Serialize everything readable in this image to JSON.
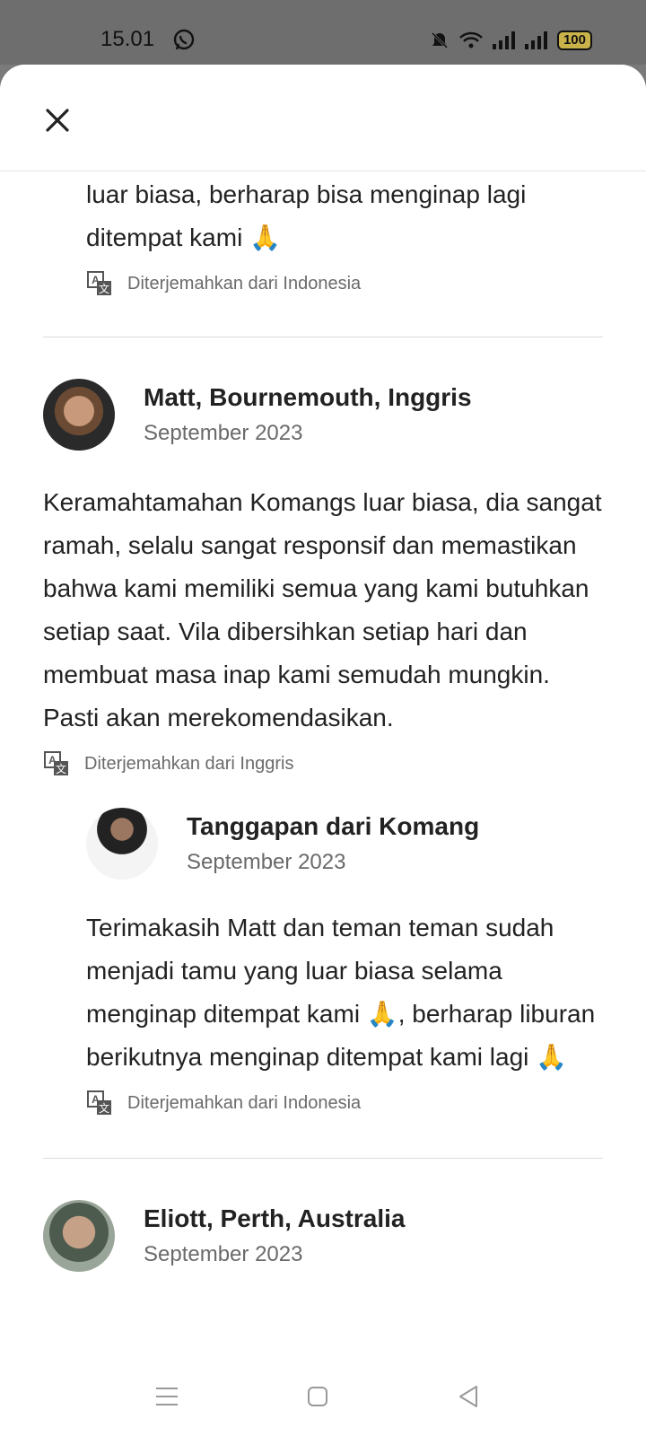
{
  "status_bar": {
    "time": "15.01",
    "battery": "100",
    "icons": [
      "whatsapp-icon",
      "mute-icon",
      "wifi-icon",
      "signal-icon",
      "signal-icon",
      "battery-icon"
    ]
  },
  "header": {
    "close_icon": "close-icon"
  },
  "reviews": {
    "prev_response": {
      "text": "luar biasa, berharap bisa menginap lagi ditempat kami 🙏",
      "translated": "Diterjemahkan dari Indonesia"
    },
    "matt": {
      "name": "Matt, Bournemouth, Inggris",
      "date": "September 2023",
      "text": "Keramahtamahan Komangs luar biasa, dia sangat ramah, selalu sangat responsif dan memastikan bahwa kami memiliki semua yang kami butuhkan setiap saat. Vila dibersihkan setiap hari dan membuat masa inap kami semudah mungkin. Pasti akan merekomendasikan.",
      "translated": "Diterjemahkan dari Inggris"
    },
    "komang_response": {
      "name": "Tanggapan dari Komang",
      "date": "September 2023",
      "text": "Terimakasih Matt dan teman teman sudah menjadi tamu yang luar biasa selama menginap ditempat kami 🙏, berharap liburan berikutnya menginap ditempat kami lagi 🙏",
      "translated": "Diterjemahkan dari Indonesia"
    },
    "eliott": {
      "name": "Eliott, Perth, Australia",
      "date": "September 2023"
    }
  },
  "nav": {
    "icons": [
      "menu-icon",
      "home-icon",
      "back-icon"
    ]
  }
}
